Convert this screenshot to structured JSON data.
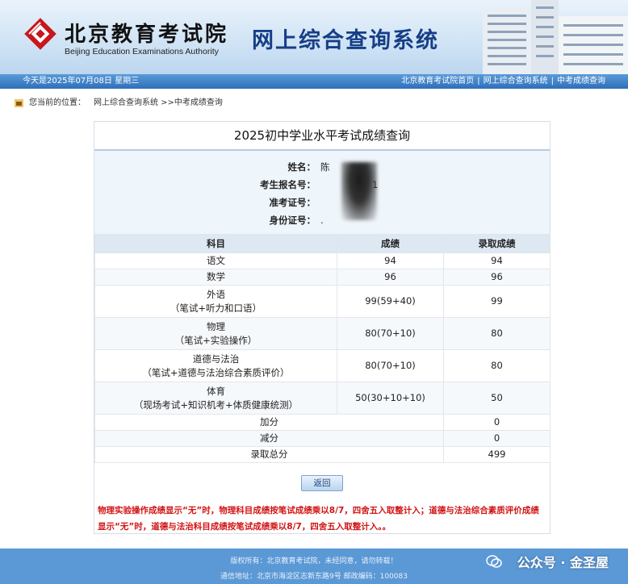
{
  "header": {
    "org_name_cn": "北京教育考试院",
    "org_name_en": "Beijing Education Examinations Authority",
    "system_title": "网上综合查询系统",
    "accent": "#163e86"
  },
  "nav": {
    "date_text": "今天是2025年07月08日 星期三",
    "links": [
      "北京教育考试院首页",
      "网上综合查询系统",
      "中考成绩查询"
    ]
  },
  "breadcrumb": {
    "label": "您当前的位置：",
    "path": "网上综合查询系统 >>中考成绩查询"
  },
  "result": {
    "title": "2025初中学业水平考试成绩查询",
    "fields": [
      {
        "label": "姓名：",
        "value": "陈"
      },
      {
        "label": "考生报名号：",
        "value": "1"
      },
      {
        "label": "准考证号：",
        "value": ""
      },
      {
        "label": "身份证号：",
        "value": "."
      }
    ],
    "columns": [
      "科目",
      "成绩",
      "录取成绩"
    ],
    "rows": [
      {
        "subject": "语文",
        "detail": "",
        "score": "94",
        "admit": "94"
      },
      {
        "subject": "数学",
        "detail": "",
        "score": "96",
        "admit": "96"
      },
      {
        "subject": "外语",
        "detail": "（笔试+听力和口语）",
        "score": "99(59+40)",
        "admit": "99"
      },
      {
        "subject": "物理",
        "detail": "（笔试+实验操作）",
        "score": "80(70+10)",
        "admit": "80"
      },
      {
        "subject": "道德与法治",
        "detail": "（笔试+道德与法治综合素质评价）",
        "score": "80(70+10)",
        "admit": "80"
      },
      {
        "subject": "体育",
        "detail": "（现场考试+知识机考+体质健康统测）",
        "score": "50(30+10+10)",
        "admit": "50"
      },
      {
        "subject": "加分",
        "detail": "",
        "score": "",
        "admit": "0"
      },
      {
        "subject": "减分",
        "detail": "",
        "score": "",
        "admit": "0"
      },
      {
        "subject": "录取总分",
        "detail": "",
        "score": "",
        "admit": "499"
      }
    ],
    "back_label": "返回",
    "notice": "物理实验操作成绩显示“无”时，物理科目成绩按笔试成绩乘以8/7，四舍五入取整计入；道德与法治综合素质评价成绩显示“无”时，道德与法治科目成绩按笔试成绩乘以8/7，四舍五入取整计入。。",
    "notice_color": "#d11414"
  },
  "footer": {
    "line1": "版权所有：北京教育考试院，未经同意，请勿转载！",
    "line2": "通信地址：北京市海淀区志新东路9号 邮政编码：100083"
  },
  "watermark": {
    "text": "公众号 · 金圣屋",
    "icon": "wechat-icon"
  }
}
